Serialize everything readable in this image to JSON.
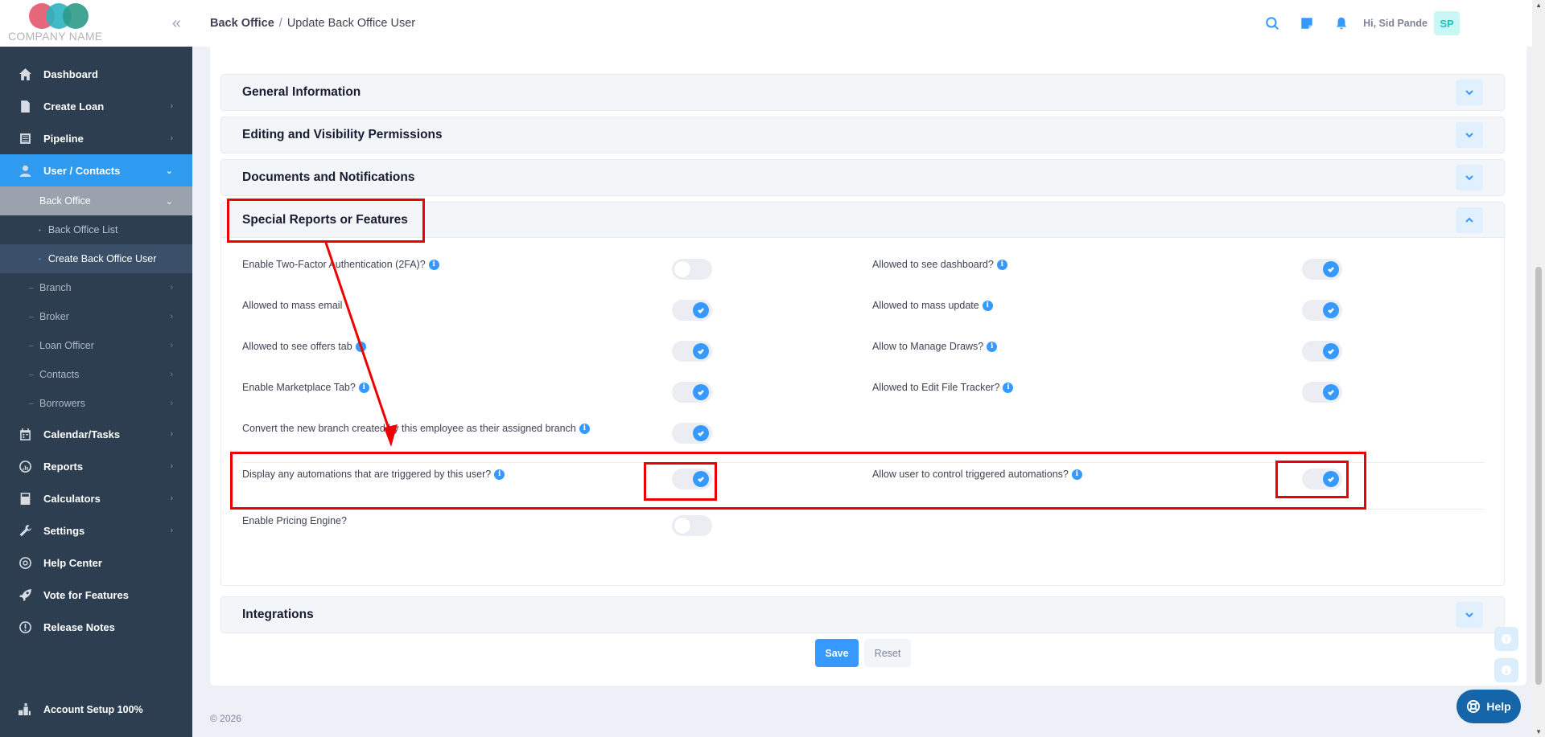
{
  "brand": {
    "company_name": "COMPANY NAME"
  },
  "sidebar": {
    "items": [
      {
        "label": "Dashboard",
        "icon": "home-icon"
      },
      {
        "label": "Create Loan",
        "icon": "document-icon"
      },
      {
        "label": "Pipeline",
        "icon": "list-icon"
      },
      {
        "label": "User / Contacts",
        "icon": "user-icon"
      }
    ],
    "back_office": "Back Office",
    "back_office_list": "Back Office List",
    "create_back_office_user": "Create Back Office User",
    "sub_items": [
      "Branch",
      "Broker",
      "Loan Officer",
      "Contacts",
      "Borrowers"
    ],
    "lower_items": [
      {
        "label": "Calendar/Tasks",
        "icon": "calendar-icon"
      },
      {
        "label": "Reports",
        "icon": "chart-icon"
      },
      {
        "label": "Calculators",
        "icon": "calculator-icon"
      },
      {
        "label": "Settings",
        "icon": "wrench-icon"
      },
      {
        "label": "Help Center",
        "icon": "lifebuoy-icon"
      },
      {
        "label": "Vote for Features",
        "icon": "rocket-icon"
      },
      {
        "label": "Release Notes",
        "icon": "info-circle-icon"
      }
    ],
    "account_setup": "Account Setup 100%"
  },
  "header": {
    "breadcrumb_root": "Back Office",
    "breadcrumb_sep": "/",
    "breadcrumb_page": "Update Back Office User",
    "greeting": "Hi, Sid Pande",
    "avatar_initials": "SP"
  },
  "sections": {
    "general": "General Information",
    "editing": "Editing and Visibility Permissions",
    "documents": "Documents and Notifications",
    "special": "Special Reports or Features",
    "integrations": "Integrations"
  },
  "options": {
    "two_factor": {
      "label": "Enable Two-Factor Authentication (2FA)?",
      "on": false
    },
    "see_dashboard": {
      "label": "Allowed to see dashboard?",
      "on": true
    },
    "mass_email": {
      "label": "Allowed to mass email",
      "on": true
    },
    "mass_update": {
      "label": "Allowed to mass update",
      "on": true
    },
    "offers_tab": {
      "label": "Allowed to see offers tab",
      "on": true
    },
    "manage_draws": {
      "label": "Allow to Manage Draws?",
      "on": true
    },
    "marketplace_tab": {
      "label": "Enable Marketplace Tab?",
      "on": true
    },
    "edit_file_tracker": {
      "label": "Allowed to Edit File Tracker?",
      "on": true
    },
    "convert_branch": {
      "label": "Convert the new branch created by this employee as their assigned branch",
      "on": true
    },
    "display_automations": {
      "label": "Display any automations that are triggered by this user?",
      "on": true
    },
    "control_automations": {
      "label": "Allow user to control triggered automations?",
      "on": true
    },
    "pricing_engine": {
      "label": "Enable Pricing Engine?",
      "on": false
    }
  },
  "buttons": {
    "save": "Save",
    "reset": "Reset",
    "help": "Help"
  },
  "footer": {
    "copyright": "© 2026"
  },
  "colors": {
    "accent": "#3699ff",
    "sidebar": "#2c3e50",
    "annotation": "#e00000"
  }
}
